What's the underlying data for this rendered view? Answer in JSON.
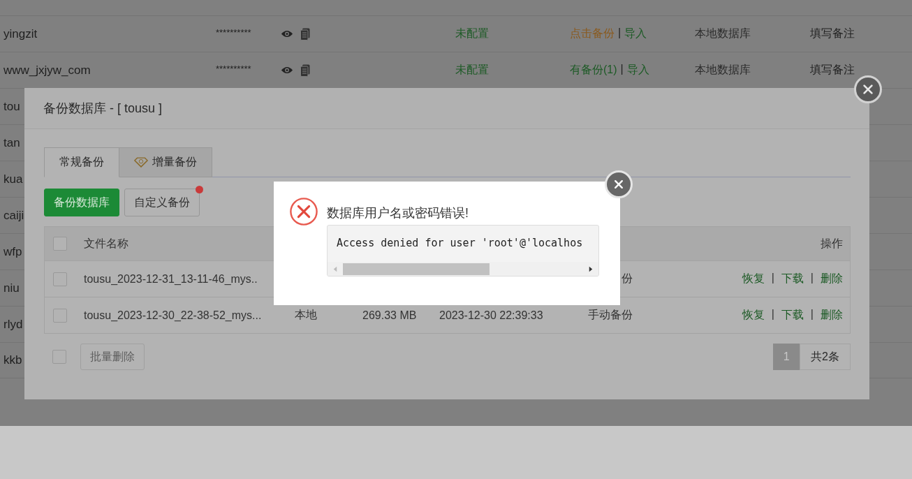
{
  "page_rows": [
    {
      "name": "yingzit",
      "password": "**********",
      "capacity": "未配置",
      "backup": {
        "text": "点击备份",
        "kind": "action"
      },
      "separator": "|",
      "import": "导入",
      "location": "本地数据库",
      "note": "填写备注"
    },
    {
      "name": "www_jxjyw_com",
      "password": "**********",
      "capacity": "未配置",
      "backup": {
        "text": "有备份(1)",
        "kind": "exists"
      },
      "separator": "|",
      "import": "导入",
      "location": "本地数据库",
      "note": "填写备注"
    },
    {
      "name": "tou"
    },
    {
      "name": "tan"
    },
    {
      "name": "kua"
    },
    {
      "name": "caiji"
    },
    {
      "name": "wfp"
    },
    {
      "name": "niu"
    },
    {
      "name": "rlyd"
    },
    {
      "name": "kkb"
    }
  ],
  "dialog": {
    "title": "备份数据库 - [ tousu ]",
    "tabs": [
      {
        "label": "常规备份",
        "selected": true,
        "kind": "plain"
      },
      {
        "label": "增量备份",
        "selected": false,
        "kind": "premium"
      }
    ],
    "buttons": [
      {
        "label": "备份数据库",
        "kind": "primary",
        "dot": false
      },
      {
        "label": "自定义备份",
        "kind": "default",
        "dot": true
      }
    ],
    "table": {
      "header": {
        "checked": false,
        "filename": "文件名称",
        "actions": "操作"
      },
      "rows": [
        {
          "checked": false,
          "filename": "tousu_2023-12-31_13-11-46_mys..",
          "type": "份",
          "actions": [
            "恢复",
            "下载",
            "删除"
          ],
          "separator": "|"
        },
        {
          "checked": false,
          "filename": "tousu_2023-12-30_22-38-52_mys...",
          "location": "本地",
          "size": "269.33 MB",
          "time": "2023-12-30 22:39:33",
          "type": "手动备份",
          "actions": [
            "恢复",
            "下载",
            "删除"
          ],
          "separator": "|"
        }
      ]
    },
    "footer": {
      "checked": false,
      "batch_delete": {
        "label": "批量删除",
        "disabled": true
      },
      "pages": [
        {
          "label": "1",
          "selected": true
        }
      ],
      "total": "共2条"
    }
  },
  "error_popup": {
    "message": "数据库用户名或密码错误!",
    "detail": "Access denied for user 'root'@'localhos"
  }
}
